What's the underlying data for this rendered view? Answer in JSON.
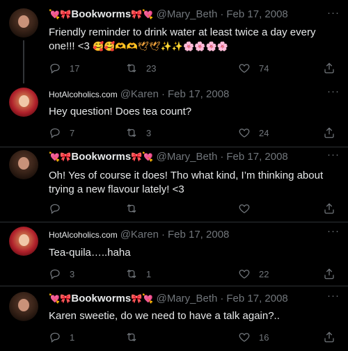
{
  "tweets": [
    {
      "display_name": "Bookworms",
      "handle": "@Mary_Beth",
      "date": "Feb 17, 2008",
      "text": "Friendly reminder to drink water at least twice a day every one!!! <3",
      "emoji_tail": "🥰🥰🫶🫶🕊🕊✨✨🌸🌸🌸🌸",
      "replies": "17",
      "retweets": "23",
      "likes": "74",
      "avatar": "brunette-avatar"
    },
    {
      "display_name": "HotAlcoholics.com",
      "handle": "@Karen",
      "date": "Feb 17, 2008",
      "text": "Hey question! Does tea count?",
      "replies": "7",
      "retweets": "3",
      "likes": "24",
      "avatar": "blonde-avatar"
    },
    {
      "display_name": "Bookworms",
      "handle": "@Mary_Beth",
      "date": "Feb 17, 2008",
      "text": "Oh! Yes of course it does! Tho what kind, I’m thinking about trying a new flavour lately! <3",
      "replies": "",
      "retweets": "",
      "likes": "",
      "avatar": "brunette-avatar"
    },
    {
      "display_name": "HotAlcoholics.com",
      "handle": "@Karen",
      "date": "Feb 17, 2008",
      "text": "Tea-quila…..haha",
      "replies": "3",
      "retweets": "1",
      "likes": "22",
      "avatar": "blonde-avatar"
    },
    {
      "display_name": "Bookworms",
      "handle": "@Mary_Beth",
      "date": "Feb 17, 2008",
      "text": "Karen sweetie, do we need to have a talk again?..",
      "replies": "1",
      "retweets": "",
      "likes": "16",
      "avatar": "brunette-avatar"
    }
  ],
  "name_decor": {
    "left": "💘🎀",
    "right": "🎀💘"
  },
  "separator": "·",
  "more_label": "···",
  "icons": {
    "reply": "reply-icon",
    "retweet": "retweet-icon",
    "like": "heart-icon",
    "share": "share-icon"
  },
  "colors": {
    "background": "#000000",
    "text": "#e7e9ea",
    "muted": "#71767b",
    "divider": "#2f3336"
  }
}
